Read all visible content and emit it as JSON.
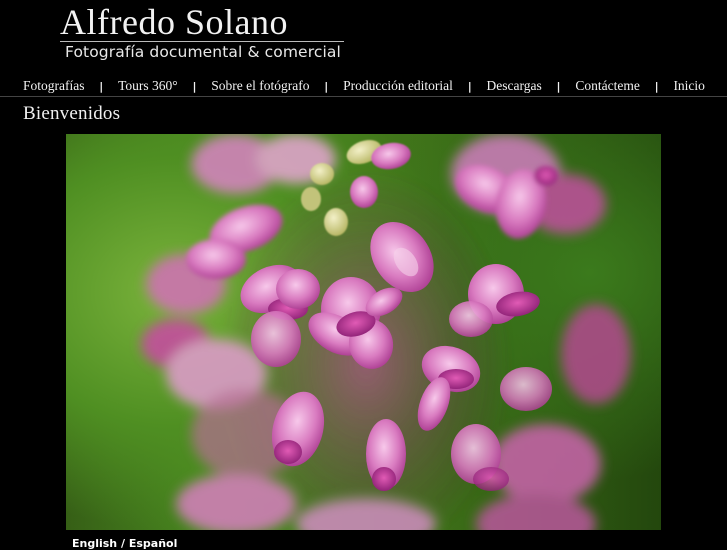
{
  "header": {
    "title": "Alfredo Solano",
    "subtitle": "Fotografía documental & comercial"
  },
  "nav": {
    "items": [
      {
        "label": "Fotografías"
      },
      {
        "label": "Tours 360°"
      },
      {
        "label": "Sobre el fotógrafo"
      },
      {
        "label": "Producción editorial"
      },
      {
        "label": "Descargas"
      },
      {
        "label": "Contácteme"
      },
      {
        "label": "Inicio"
      }
    ],
    "separator": "|"
  },
  "main": {
    "heading": "Bienvenidos",
    "photo_subject": "pink orchid flower close-up",
    "colors": {
      "background": "#000000",
      "flower": "#d86bb8",
      "foliage": "#4a8a20"
    }
  },
  "footer": {
    "lang_english": "English",
    "lang_sep": "/",
    "lang_spanish": "Español"
  }
}
